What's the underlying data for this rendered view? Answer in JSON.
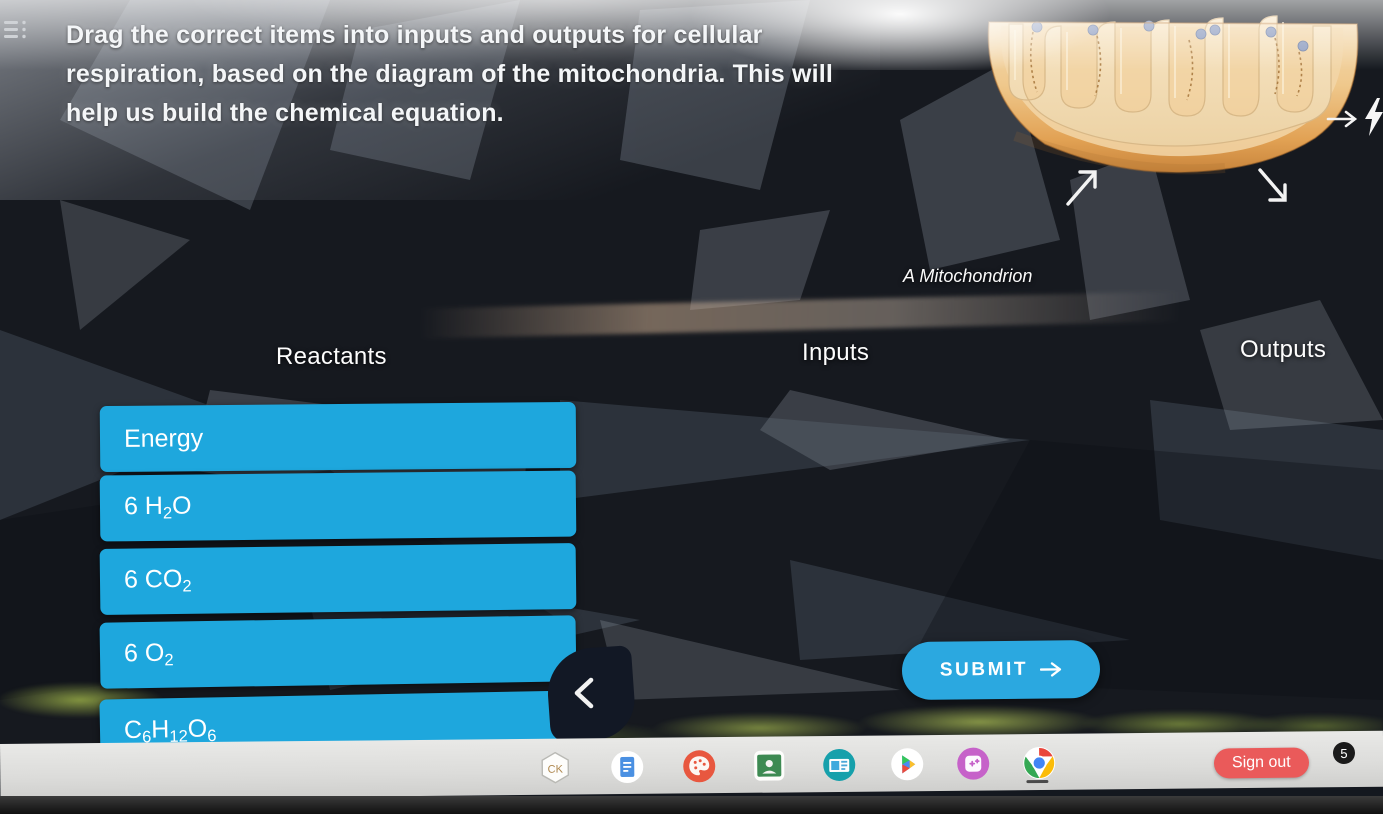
{
  "screen": {
    "device": "chromebook",
    "background_description": "dark abstract geometric shard wallpaper with mossy grass strip"
  },
  "header": {
    "question": "Drag the correct items into inputs and outputs for cellular respiration, based on the diagram of the mitochondria. This will help us build the chemical equation.",
    "menu_icon": "hamburger-icon"
  },
  "diagram": {
    "caption": "A Mitochondrion",
    "arrow_icons": [
      "arrow-up-right-icon",
      "arrow-down-right-icon",
      "arrow-right-icon"
    ],
    "energy_icon": "lightning-bolt-icon"
  },
  "columns": [
    {
      "id": "reactants",
      "label": "Reactants"
    },
    {
      "id": "inputs",
      "label": "Inputs"
    },
    {
      "id": "outputs",
      "label": "Outputs"
    }
  ],
  "reactants": {
    "chips": [
      {
        "id": "energy",
        "label": "Energy",
        "html": "Energy"
      },
      {
        "id": "water",
        "label": "6 H2O",
        "html": "6 H<sub>2</sub>O"
      },
      {
        "id": "co2",
        "label": "6 CO2",
        "html": "6 CO<sub>2</sub>"
      },
      {
        "id": "o2",
        "label": "6 O2",
        "html": "6 O<sub>2</sub>"
      },
      {
        "id": "glucose",
        "label": "C6H12O6",
        "html": "C<sub>6</sub>H<sub>12</sub>O<sub>6</sub>"
      }
    ]
  },
  "nav": {
    "back_icon": "chevron-left-icon"
  },
  "actions": {
    "submit_label": "SUBMIT",
    "submit_icon": "arrow-right-icon"
  },
  "shelf": {
    "sign_out_label": "Sign out",
    "notification_count": "5",
    "icons": [
      {
        "id": "ck",
        "name": "ck-hexagon-icon"
      },
      {
        "id": "docs",
        "name": "google-docs-icon"
      },
      {
        "id": "palette",
        "name": "art-palette-icon"
      },
      {
        "id": "classroom",
        "name": "google-classroom-icon"
      },
      {
        "id": "news",
        "name": "news-slides-icon"
      },
      {
        "id": "play",
        "name": "google-play-icon"
      },
      {
        "id": "sparkle",
        "name": "purple-sparkle-app-icon"
      },
      {
        "id": "chrome",
        "name": "google-chrome-icon"
      }
    ]
  },
  "colors": {
    "chip_blue": "#1ea7dd",
    "submit_blue": "#2ba8e0",
    "sign_out_red": "#ea5a5a",
    "text_white": "#ffffff",
    "shelf_gray": "#e0e0de",
    "mitochondrion_orange": "#e7a24d"
  }
}
